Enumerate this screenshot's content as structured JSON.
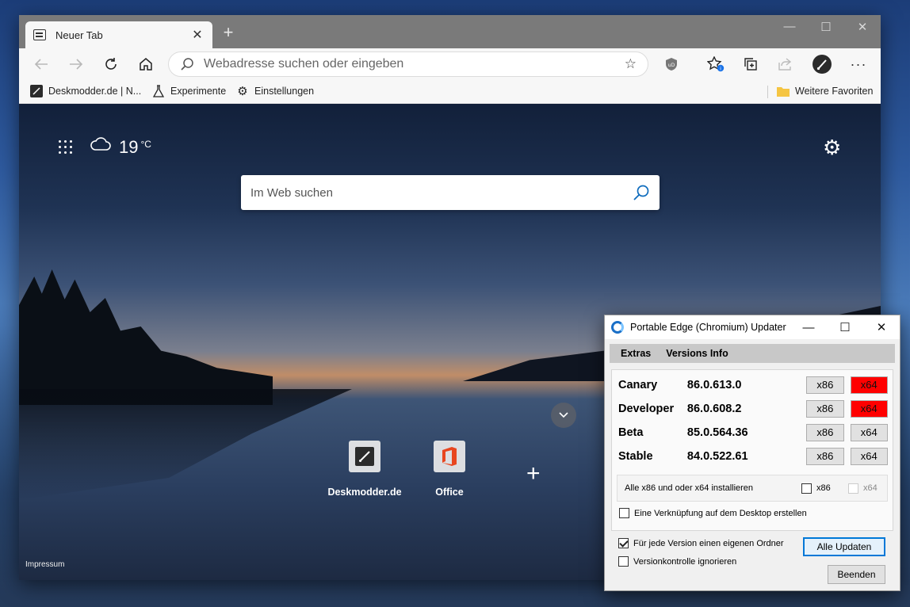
{
  "browser": {
    "tab_title": "Neuer Tab",
    "address_placeholder": "Webadresse suchen oder eingeben",
    "favorites": [
      {
        "label": "Deskmodder.de | N..."
      },
      {
        "label": "Experimente"
      },
      {
        "label": "Einstellungen"
      }
    ],
    "more_favorites": "Weitere Favoriten"
  },
  "ntp": {
    "temperature": "19",
    "temperature_unit": "°C",
    "search_placeholder": "Im Web suchen",
    "quick_links": [
      {
        "label": "Deskmodder.de"
      },
      {
        "label": "Office"
      }
    ],
    "impressum": "Impressum"
  },
  "updater": {
    "title": "Portable Edge (Chromium) Updater",
    "menu": [
      "Extras",
      "Versions Info"
    ],
    "versions": [
      {
        "name": "Canary",
        "version": "86.0.613.0",
        "x86": "x86",
        "x64": "x64"
      },
      {
        "name": "Developer",
        "version": "86.0.608.2",
        "x86": "x86",
        "x64": "x64"
      },
      {
        "name": "Beta",
        "version": "85.0.564.36",
        "x86": "x86",
        "x64": "x64"
      },
      {
        "name": "Stable",
        "version": "84.0.522.61",
        "x86": "x86",
        "x64": "x64"
      }
    ],
    "install_all_label": "Alle x86 und oder x64 installieren",
    "install_all_x86": "x86",
    "install_all_x64": "x64",
    "desktop_shortcut_label": "Eine Verknüpfung auf dem Desktop erstellen",
    "own_folder_label": "Für jede Version einen eigenen Ordner",
    "ignore_version_label": "Versionkontrolle ignorieren",
    "update_all_button": "Alle Updaten",
    "exit_button": "Beenden",
    "own_folder_checked": true,
    "highlight_color": "#ff0000"
  }
}
